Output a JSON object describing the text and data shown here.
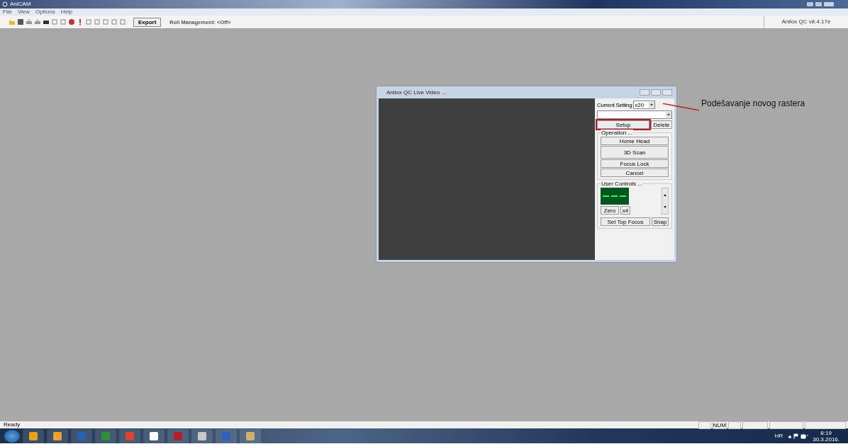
{
  "window": {
    "title": "AniCAM"
  },
  "menu": [
    "File",
    "View",
    "Options",
    "Help"
  ],
  "toolbar": {
    "export": "Export",
    "roll_management": "Roll Management: <Off>",
    "version": "Anilox QC v8.4.17e"
  },
  "live_video": {
    "title": "Anilox QC Live Video ...",
    "current_setting_label": "Current Setting",
    "current_setting": "x20",
    "setup": {
      "label": "Setup",
      "highlighted": true
    },
    "delete": "Delete",
    "operation": {
      "title": "Operation ...",
      "buttons": [
        "Home Head",
        "3D Scan",
        "Focus Lock",
        "Cancel"
      ]
    },
    "user_controls": {
      "title": "User Controls ...",
      "zero": "Zero",
      "x4": "x4",
      "set_top_focus": "Set Top Focus",
      "snap": "Snap"
    }
  },
  "annotation": "Podešavanje novog rastera",
  "status_bar": {
    "text": "Ready",
    "indicators": [
      "NUM"
    ]
  },
  "tray": {
    "language": "HR",
    "time": "8:19",
    "date": "30.3.2016."
  }
}
